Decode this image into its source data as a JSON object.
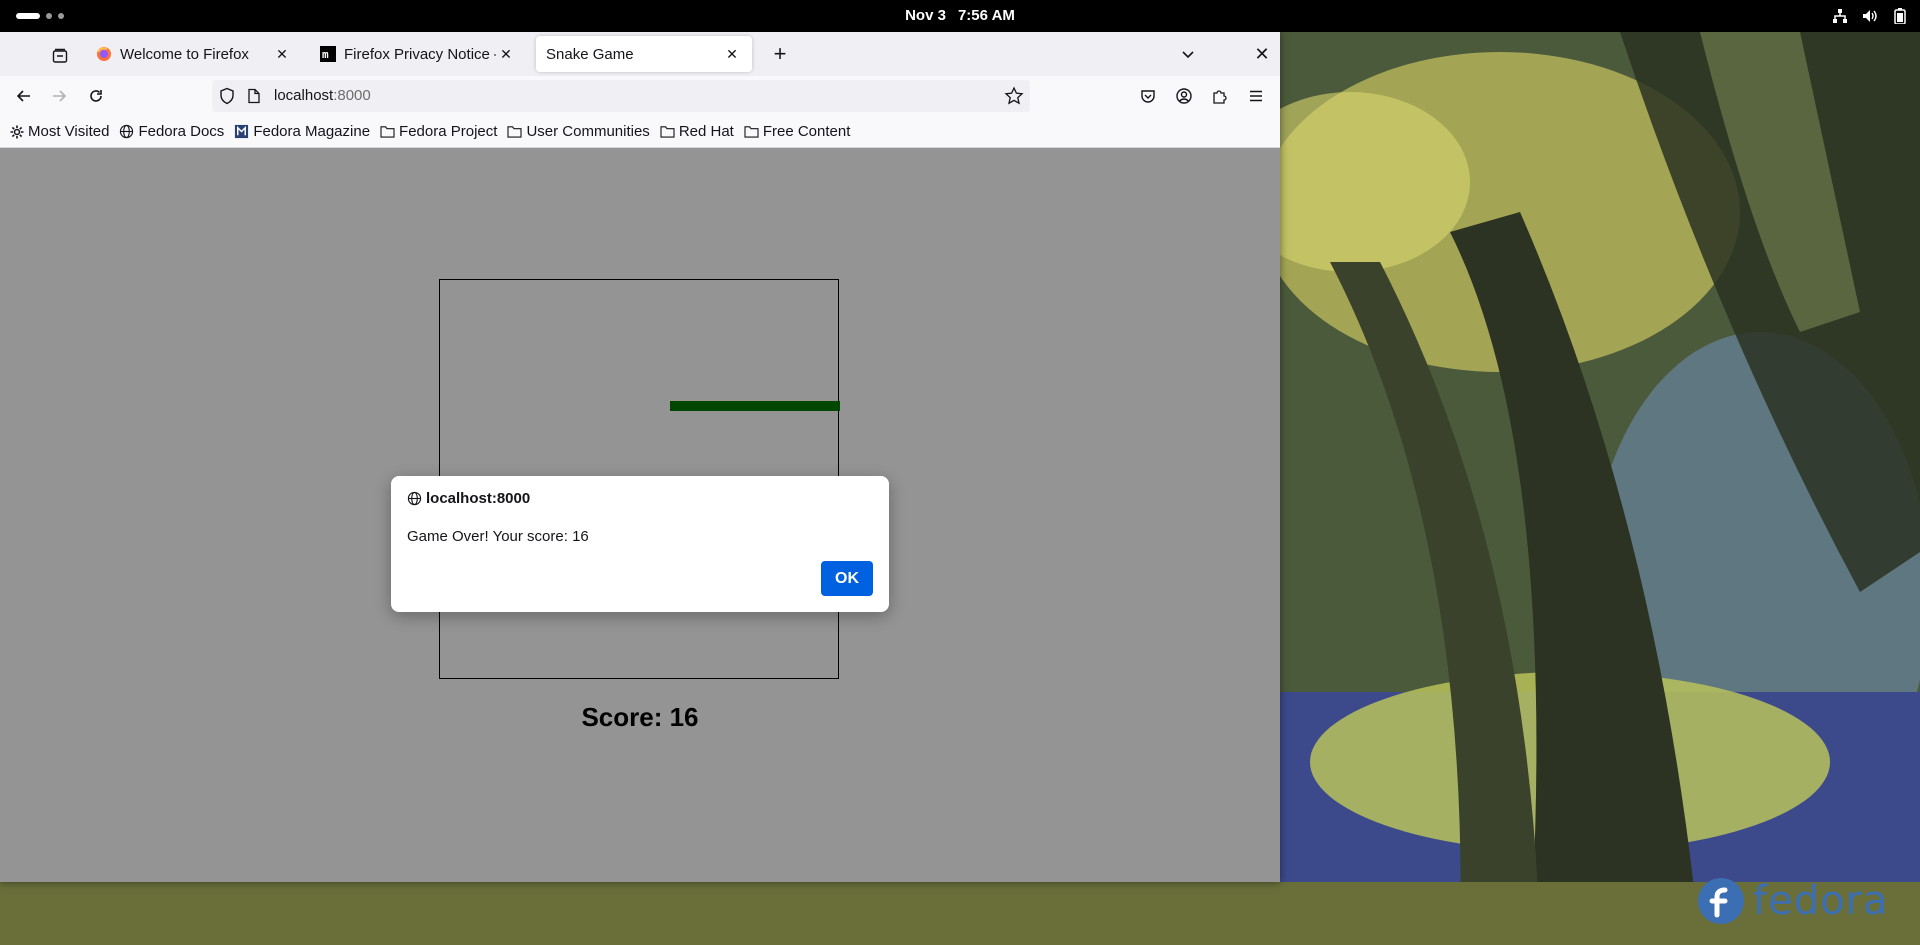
{
  "topbar": {
    "date": "Nov 3",
    "time": "7:56 AM",
    "tray_icons": [
      "network-icon",
      "volume-icon",
      "battery-icon"
    ]
  },
  "browser": {
    "tabs": [
      {
        "title": "Welcome to Firefox",
        "icon": "firefox-icon",
        "selected": false
      },
      {
        "title": "Firefox Privacy Notice — M",
        "icon": "mozilla-icon",
        "selected": false
      },
      {
        "title": "Snake Game",
        "icon": "",
        "selected": true
      }
    ],
    "url": {
      "host": "localhost",
      "port": ":8000"
    },
    "bookmarks": [
      {
        "label": "Most Visited",
        "icon": "gear-icon"
      },
      {
        "label": "Fedora Docs",
        "icon": "globe-icon"
      },
      {
        "label": "Fedora Magazine",
        "icon": "fedora-magazine-icon"
      },
      {
        "label": "Fedora Project",
        "icon": "folder-icon"
      },
      {
        "label": "User Communities",
        "icon": "folder-icon"
      },
      {
        "label": "Red Hat",
        "icon": "folder-icon"
      },
      {
        "label": "Free Content",
        "icon": "folder-icon"
      }
    ]
  },
  "game": {
    "score_text": "Score: 16",
    "snake_color": "#007d00"
  },
  "dialog": {
    "origin": "localhost:8000",
    "message": "Game Over! Your score: 16",
    "ok_label": "OK",
    "ok_color": "#0061e0"
  },
  "desktop": {
    "logo_text": "fedora"
  }
}
